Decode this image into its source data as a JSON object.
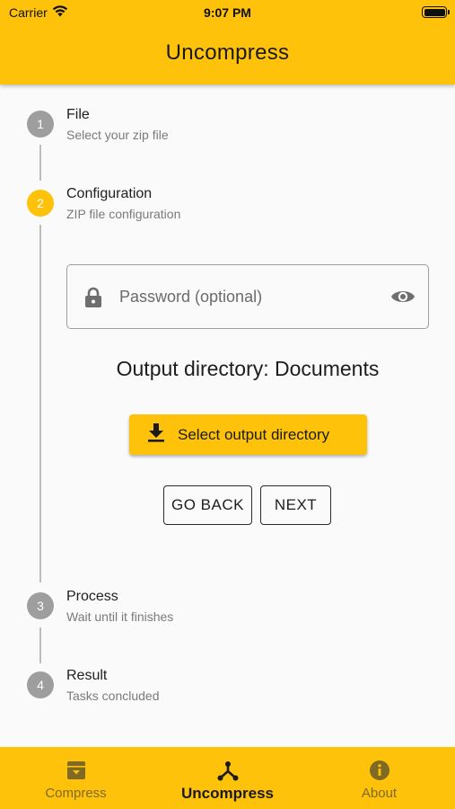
{
  "status_bar": {
    "carrier": "Carrier",
    "time": "9:07 PM",
    "battery_level": 1.0
  },
  "app_bar": {
    "title": "Uncompress"
  },
  "steps": [
    {
      "number": "1",
      "title": "File",
      "subtitle": "Select your zip file",
      "state": "inactive"
    },
    {
      "number": "2",
      "title": "Configuration",
      "subtitle": "ZIP file configuration",
      "state": "active"
    },
    {
      "number": "3",
      "title": "Process",
      "subtitle": "Wait until it finishes",
      "state": "inactive"
    },
    {
      "number": "4",
      "title": "Result",
      "subtitle": "Tasks concluded",
      "state": "inactive"
    }
  ],
  "config": {
    "password": {
      "value": "",
      "placeholder": "Password (optional)",
      "leading_icon": "lock-icon",
      "trailing_icon": "eye-icon"
    },
    "output_directory": "Output directory: Documents",
    "select_button": {
      "label": "Select output directory",
      "icon": "download-icon"
    },
    "back_button": "GO BACK",
    "next_button": "NEXT"
  },
  "bottom_nav": {
    "items": [
      {
        "label": "Compress",
        "icon": "archive-icon",
        "selected": false
      },
      {
        "label": "Uncompress",
        "icon": "split-icon",
        "selected": true
      },
      {
        "label": "About",
        "icon": "info-icon",
        "selected": false
      }
    ]
  },
  "colors": {
    "accent": "#fec20b",
    "inactive_step": "#9e9e9e",
    "background": "#fafafa",
    "nav_inactive": "#7f6a25"
  }
}
